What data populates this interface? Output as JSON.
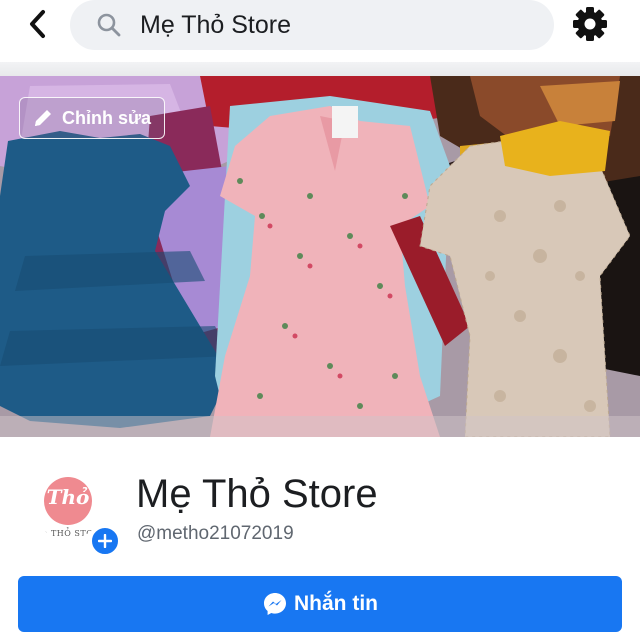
{
  "header": {
    "search_value": "Mẹ Thỏ Store",
    "back_icon": "chevron-left-icon",
    "search_icon": "search-icon",
    "settings_icon": "gear-icon"
  },
  "cover": {
    "edit_label": "Chỉnh sửa",
    "edit_icon": "pencil-icon"
  },
  "profile": {
    "avatar_logo_text": "Thỏ",
    "avatar_caption": "Mẹ THỎ STORE",
    "add_icon": "plus-icon",
    "name": "Mẹ Thỏ Store",
    "handle": "@metho21072019"
  },
  "actions": {
    "message_label": "Nhắn tin",
    "message_icon": "messenger-icon"
  },
  "colors": {
    "accent": "#1877f2",
    "search_bg": "#eff1f4",
    "avatar_logo": "#ef8a90"
  }
}
